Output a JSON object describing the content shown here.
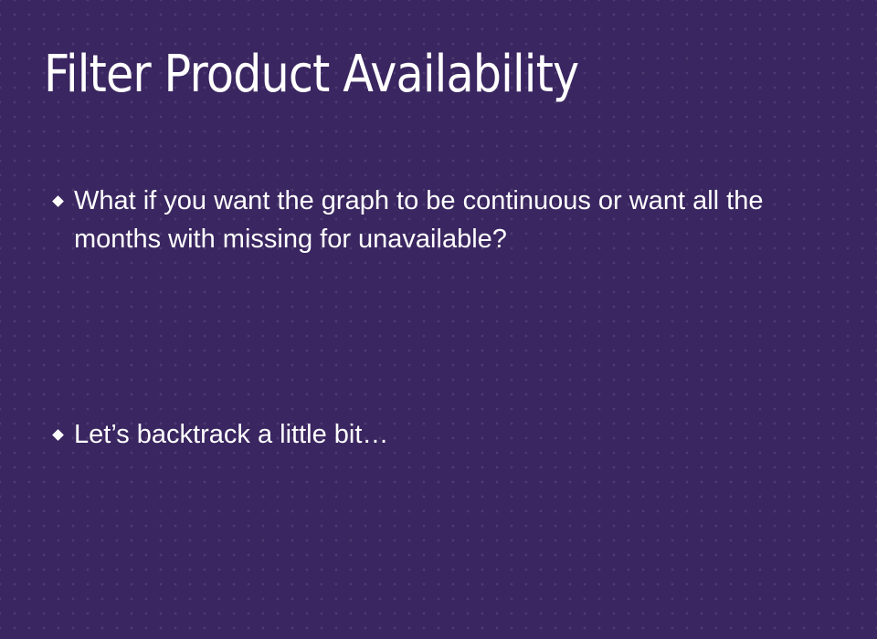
{
  "slide": {
    "title": "Filter Product Availability",
    "bullets": [
      {
        "text": "What if you want the graph to be continuous or want all the months with missing for unavailable?"
      },
      {
        "text": "Let’s backtrack a little bit…"
      }
    ]
  },
  "colors": {
    "background": "#3a2660",
    "text": "#ffffff"
  }
}
